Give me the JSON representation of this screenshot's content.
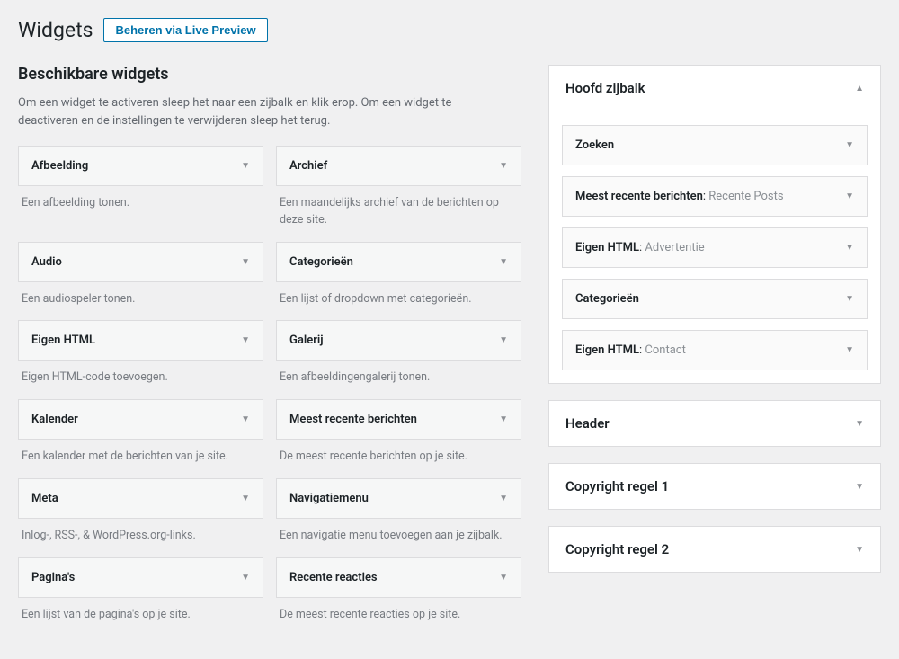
{
  "header": {
    "title": "Widgets",
    "live_preview": "Beheren via Live Preview"
  },
  "available": {
    "title": "Beschikbare widgets",
    "description": "Om een widget te activeren sleep het naar een zijbalk en klik erop. Om een widget te deactiveren en de instellingen te verwijderen sleep het terug.",
    "widgets": [
      {
        "title": "Afbeelding",
        "desc": "Een afbeelding tonen."
      },
      {
        "title": "Archief",
        "desc": "Een maandelijks archief van de berichten op deze site."
      },
      {
        "title": "Audio",
        "desc": "Een audiospeler tonen."
      },
      {
        "title": "Categorieën",
        "desc": "Een lijst of dropdown met categorieën."
      },
      {
        "title": "Eigen HTML",
        "desc": "Eigen HTML-code toevoegen."
      },
      {
        "title": "Galerij",
        "desc": "Een afbeeldingengalerij tonen."
      },
      {
        "title": "Kalender",
        "desc": "Een kalender met de berichten van je site."
      },
      {
        "title": "Meest recente berichten",
        "desc": "De meest recente berichten op je site."
      },
      {
        "title": "Meta",
        "desc": "Inlog-, RSS-, & WordPress.org-links."
      },
      {
        "title": "Navigatiemenu",
        "desc": "Een navigatie menu toevoegen aan je zijbalk."
      },
      {
        "title": "Pagina's",
        "desc": "Een lijst van de pagina's op je site."
      },
      {
        "title": "Recente reacties",
        "desc": "De meest recente reacties op je site."
      }
    ]
  },
  "sidebars": {
    "main": {
      "title": "Hoofd zijbalk",
      "open": true,
      "widgets": [
        {
          "main": "Zoeken",
          "sub": ""
        },
        {
          "main": "Meest recente berichten",
          "sub": "Recente Posts"
        },
        {
          "main": "Eigen HTML",
          "sub": "Advertentie"
        },
        {
          "main": "Categorieën",
          "sub": ""
        },
        {
          "main": "Eigen HTML",
          "sub": "Contact"
        }
      ]
    },
    "header": {
      "title": "Header"
    },
    "copyright1": {
      "title": "Copyright regel 1"
    },
    "copyright2": {
      "title": "Copyright regel 2"
    }
  }
}
